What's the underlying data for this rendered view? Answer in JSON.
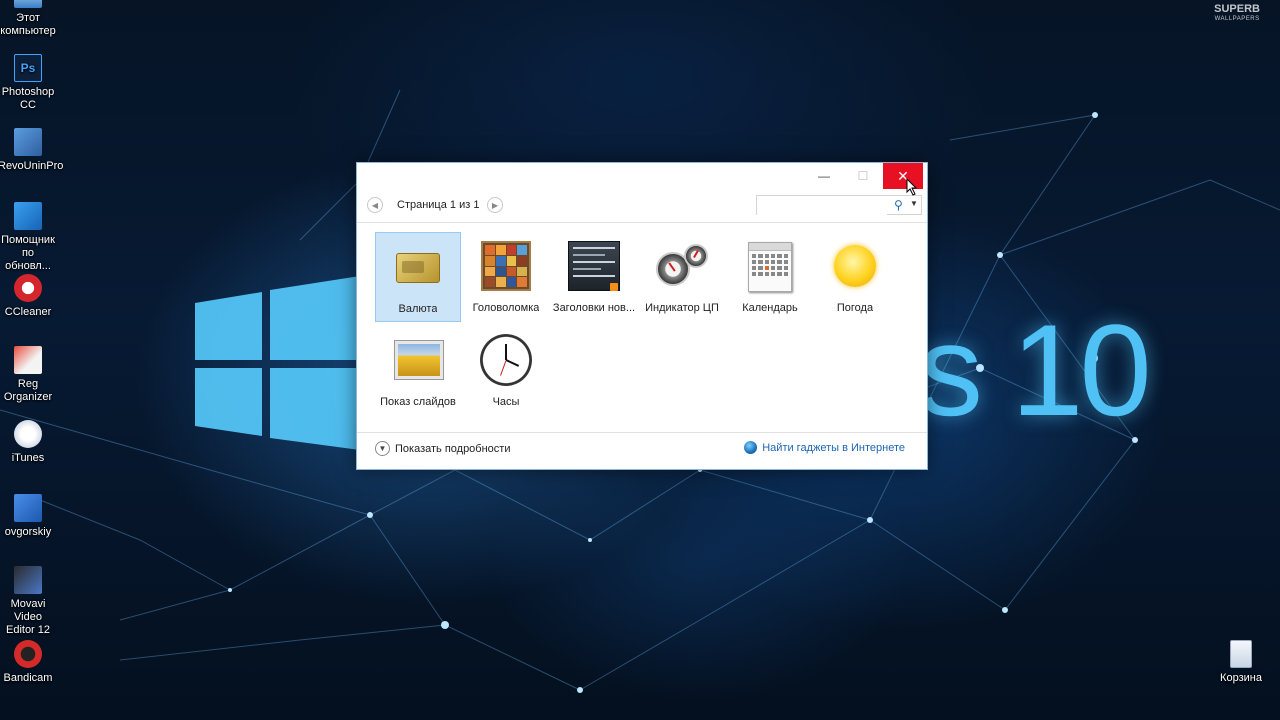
{
  "desktop": {
    "icons": [
      {
        "label": "Этот\nкомпьютер"
      },
      {
        "label": "Photoshop\nCC"
      },
      {
        "label": "RevoUninPro"
      },
      {
        "label": "Помощник\nпо обновл..."
      },
      {
        "label": "CCleaner"
      },
      {
        "label": "Reg\nOrganizer"
      },
      {
        "label": "iTunes"
      },
      {
        "label": "ovgorskiy"
      },
      {
        "label": "Movavi Video\nEditor 12"
      },
      {
        "label": "Bandicam"
      }
    ],
    "recycle_bin": {
      "label": "Корзина"
    },
    "watermark": {
      "main": "SUPERB",
      "sub": "WALLPAPERS"
    },
    "brand_text": "s 10"
  },
  "dialog": {
    "titlebar": {
      "minimize": "—",
      "maximize": "☐",
      "close": "✕"
    },
    "nav": {
      "page_label": "Страница 1 из 1",
      "prev": "◀",
      "next": "▶"
    },
    "search": {
      "value": "",
      "placeholder": ""
    },
    "gadgets": [
      {
        "label": "Валюта",
        "icon": "currency-icon",
        "selected": true
      },
      {
        "label": "Головоломка",
        "icon": "puzzle-icon",
        "selected": false
      },
      {
        "label": "Заголовки нов...",
        "icon": "news-headlines-icon",
        "selected": false
      },
      {
        "label": "Индикатор ЦП",
        "icon": "cpu-meter-icon",
        "selected": false
      },
      {
        "label": "Календарь",
        "icon": "calendar-icon",
        "selected": false
      },
      {
        "label": "Погода",
        "icon": "weather-sun-icon",
        "selected": false
      },
      {
        "label": "Показ слайдов",
        "icon": "slideshow-icon",
        "selected": false
      },
      {
        "label": "Часы",
        "icon": "clock-icon",
        "selected": false
      }
    ],
    "footer": {
      "details_label": "Показать подробности",
      "online_link": "Найти гаджеты в Интернете"
    }
  },
  "colors": {
    "close_red": "#e81123",
    "selection": "#cce4f7",
    "link": "#1c64b4",
    "win_blue": "#4fc1f5"
  }
}
